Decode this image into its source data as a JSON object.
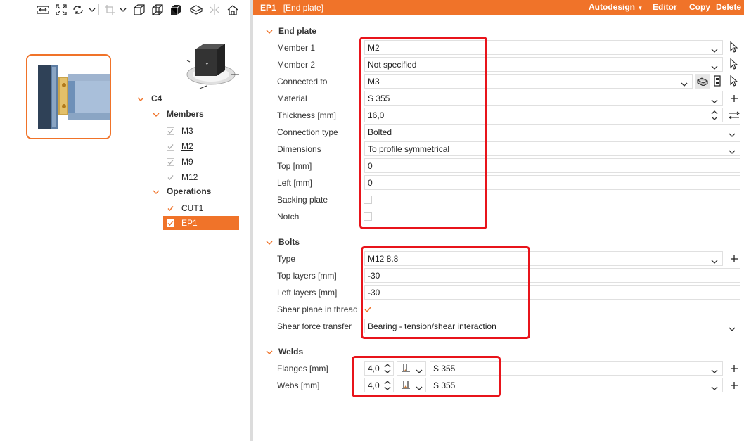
{
  "header": {
    "title": "EP1",
    "subtitle": "[End plate]",
    "actions": {
      "autodesign": "Autodesign",
      "editor": "Editor",
      "copy": "Copy",
      "delete": "Delete"
    }
  },
  "toolbar": {
    "icons": [
      "measure-icon",
      "fit-view-icon",
      "rotate-icon",
      "chevron-down-icon",
      "crop-icon",
      "chevron-down-icon",
      "wireframe-box-icon",
      "transparent-box-icon",
      "solid-box-icon",
      "plane-icon",
      "section-icon",
      "home-icon"
    ]
  },
  "tree": {
    "root": "C4",
    "members_label": "Members",
    "members": [
      "M3",
      "M2",
      "M9",
      "M12"
    ],
    "operations_label": "Operations",
    "operations": [
      "CUT1",
      "EP1"
    ]
  },
  "end_plate": {
    "section": "End plate",
    "member1": {
      "label": "Member 1",
      "value": "M2"
    },
    "member2": {
      "label": "Member 2",
      "value": "Not specified"
    },
    "connected_to": {
      "label": "Connected to",
      "value": "M3"
    },
    "material": {
      "label": "Material",
      "value": "S 355"
    },
    "thickness": {
      "label": "Thickness [mm]",
      "value": "16,0"
    },
    "connection_type": {
      "label": "Connection type",
      "value": "Bolted"
    },
    "dimensions": {
      "label": "Dimensions",
      "value": "To profile symmetrical"
    },
    "top": {
      "label": "Top [mm]",
      "value": "0"
    },
    "left": {
      "label": "Left [mm]",
      "value": "0"
    },
    "backing_plate": {
      "label": "Backing plate",
      "checked": false
    },
    "notch": {
      "label": "Notch",
      "checked": false
    }
  },
  "bolts": {
    "section": "Bolts",
    "type": {
      "label": "Type",
      "value": "M12 8.8"
    },
    "top_layers": {
      "label": "Top layers [mm]",
      "value": "-30"
    },
    "left_layers": {
      "label": "Left layers [mm]",
      "value": "-30"
    },
    "shear_plane": {
      "label": "Shear plane in thread",
      "checked": true
    },
    "shear_force": {
      "label": "Shear force transfer",
      "value": "Bearing - tension/shear interaction"
    }
  },
  "welds": {
    "section": "Welds",
    "flanges": {
      "label": "Flanges [mm]",
      "size": "4,0",
      "material": "S 355"
    },
    "webs": {
      "label": "Webs [mm]",
      "size": "4,0",
      "material": "S 355"
    }
  },
  "colors": {
    "accent": "#f07329",
    "highlight": "#e8141b"
  }
}
